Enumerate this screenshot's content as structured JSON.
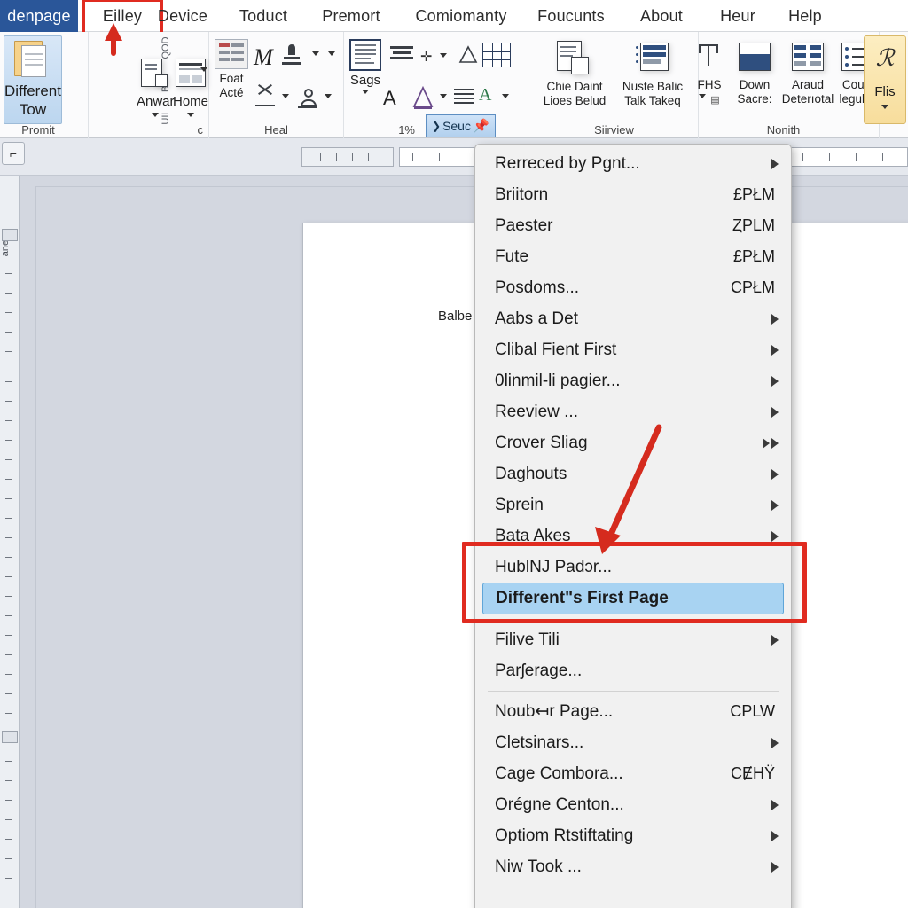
{
  "window": {
    "app_kind": "word-processor"
  },
  "ribbon": {
    "tabs": [
      {
        "label": "denpage",
        "state": "selected"
      },
      {
        "label": "Eilley",
        "state": "highlighted"
      },
      {
        "label": "Device",
        "state": "normal"
      },
      {
        "label": "Toduct",
        "state": "normal"
      },
      {
        "label": "Premort",
        "state": "normal"
      },
      {
        "label": "Comiomanty",
        "state": "normal"
      },
      {
        "label": "Foucunts",
        "state": "normal"
      },
      {
        "label": "About",
        "state": "normal"
      },
      {
        "label": "Heur",
        "state": "normal"
      },
      {
        "label": "Help",
        "state": "normal"
      }
    ],
    "groups": [
      {
        "label": "Promit"
      },
      {
        "label": "c"
      },
      {
        "label": "Heal"
      },
      {
        "label": "1%"
      },
      {
        "label": "Siirview"
      },
      {
        "label": "Nonith"
      }
    ],
    "big_button": {
      "line1": "Different",
      "line2": "Tow"
    },
    "vertical_mini_labels": [
      "QOD",
      "Bla",
      "UIL"
    ],
    "commands": {
      "anwar": "Anwar",
      "home": "Home",
      "font_act_line1": "Foat",
      "font_act_line2": "Acté",
      "sags": "Sags",
      "chie_daint_l1": "Chie Daint",
      "chie_daint_l2": "Lioes Belud",
      "nuste_balic_l1": "Nuste Balic",
      "nuste_balic_l2": "Talk Takeq",
      "fhs": "FHS",
      "down_l1": "Down",
      "down_l2": "Sacre:",
      "araud_l1": "Araud",
      "araud_l2": "Deterıotal",
      "coup_l1": "Coup",
      "coup_l2": "legults",
      "flis": "Flis"
    },
    "pin_button": "Seuc"
  },
  "ruler": {
    "corner_button_icon": "tab-stop-icon"
  },
  "document": {
    "page_text": "Balbe"
  },
  "context_menu": {
    "sections": [
      {
        "items": [
          {
            "label": "Rerreced by Pgnt...",
            "accel": "",
            "submenu": true
          },
          {
            "label": "Briitorn",
            "accel": "£PŁM",
            "submenu": false
          },
          {
            "label": "Paester",
            "accel": "ȤPLM",
            "submenu": false
          },
          {
            "label": "Fute",
            "accel": "£PŁM",
            "submenu": false
          },
          {
            "label": "Posdoms...",
            "accel": "CPŁM",
            "submenu": false
          },
          {
            "label": "Aabs a Det",
            "accel": "",
            "submenu": true
          },
          {
            "label": "Clibal Fient First",
            "accel": "",
            "submenu": true
          },
          {
            "label": "0linmil-li pagier...",
            "accel": "",
            "submenu": true
          },
          {
            "label": "Reeview ...",
            "accel": "",
            "submenu": true
          },
          {
            "label": "Crover Sliag",
            "accel": "",
            "submenu": true,
            "double_arrow": true
          },
          {
            "label": "Daghouts",
            "accel": "",
            "submenu": true
          },
          {
            "label": "Sprein",
            "accel": "",
            "submenu": true
          },
          {
            "label": "Bata Akes",
            "accel": "",
            "submenu": true
          },
          {
            "label": "HublǊ Padɔr...",
            "accel": "",
            "submenu": false
          },
          {
            "label": "Different\"s First Page",
            "accel": "",
            "submenu": false,
            "highlighted": true
          }
        ]
      },
      {
        "items": [
          {
            "label": "Filive Tili",
            "accel": "",
            "submenu": true
          },
          {
            "label": "Parʃerage...",
            "accel": "",
            "submenu": false
          }
        ]
      },
      {
        "items": [
          {
            "label": "Noub↤r Page...",
            "accel": "CPLW",
            "submenu": false
          },
          {
            "label": "Cletsinars...",
            "accel": "",
            "submenu": true
          },
          {
            "label": "Cage Combora...",
            "accel": "CɆHŸ",
            "submenu": false
          },
          {
            "label": "Orégne Centon...",
            "accel": "",
            "submenu": true
          },
          {
            "label": "Optiom Rtstiftating",
            "accel": "",
            "submenu": true
          },
          {
            "label": "Niw Took ...",
            "accel": "",
            "submenu": true
          }
        ]
      }
    ]
  },
  "annotations": {
    "accent_red": "#e02b20",
    "highlight_blue": "#a8d3f2",
    "selected_tab_blue": "#2a5699"
  }
}
